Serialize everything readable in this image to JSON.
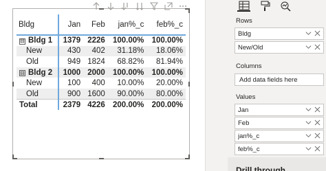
{
  "matrix": {
    "headers": [
      "Bldg",
      "Jan",
      "Feb",
      "jan%_c",
      "feb%_c"
    ],
    "rows": [
      {
        "level": 1,
        "label": "Bldg 1",
        "expander": "⊟",
        "values": [
          "1379",
          "2226",
          "100.00%",
          "100.00%"
        ]
      },
      {
        "level": 2,
        "label": "New",
        "values": [
          "430",
          "402",
          "31.18%",
          "18.06%"
        ]
      },
      {
        "level": 2,
        "label": "Old",
        "values": [
          "949",
          "1824",
          "68.82%",
          "81.94%"
        ]
      },
      {
        "level": 1,
        "label": "Bldg 2",
        "expander": "⊟",
        "values": [
          "1000",
          "2000",
          "100.00%",
          "100.00%"
        ]
      },
      {
        "level": 2,
        "label": "New",
        "values": [
          "100",
          "400",
          "10.00%",
          "20.00%"
        ]
      },
      {
        "level": 2,
        "label": "Old",
        "values": [
          "900",
          "1600",
          "90.00%",
          "80.00%"
        ]
      }
    ],
    "total": {
      "label": "Total",
      "values": [
        "2379",
        "4226",
        "200.00%",
        "200.00%"
      ]
    }
  },
  "visual_header": {
    "icons": [
      "drill-up-icon",
      "drill-down-icon",
      "go-next-level-icon",
      "expand-all-icon",
      "filter-icon",
      "focus-mode-icon",
      "more-options-icon"
    ]
  },
  "panel": {
    "rows_label": "Rows",
    "rows_fields": [
      "Bldg",
      "New/Old"
    ],
    "columns_label": "Columns",
    "columns_placeholder": "Add data fields here",
    "values_label": "Values",
    "values_fields": [
      "Jan",
      "Feb",
      "jan%_c",
      "feb%_c"
    ],
    "next_section": "Drill through"
  },
  "colors": {
    "accent": "#6fa8dc",
    "row_shade": "#eeeeee",
    "panel_bg": "#f3f2f1"
  }
}
